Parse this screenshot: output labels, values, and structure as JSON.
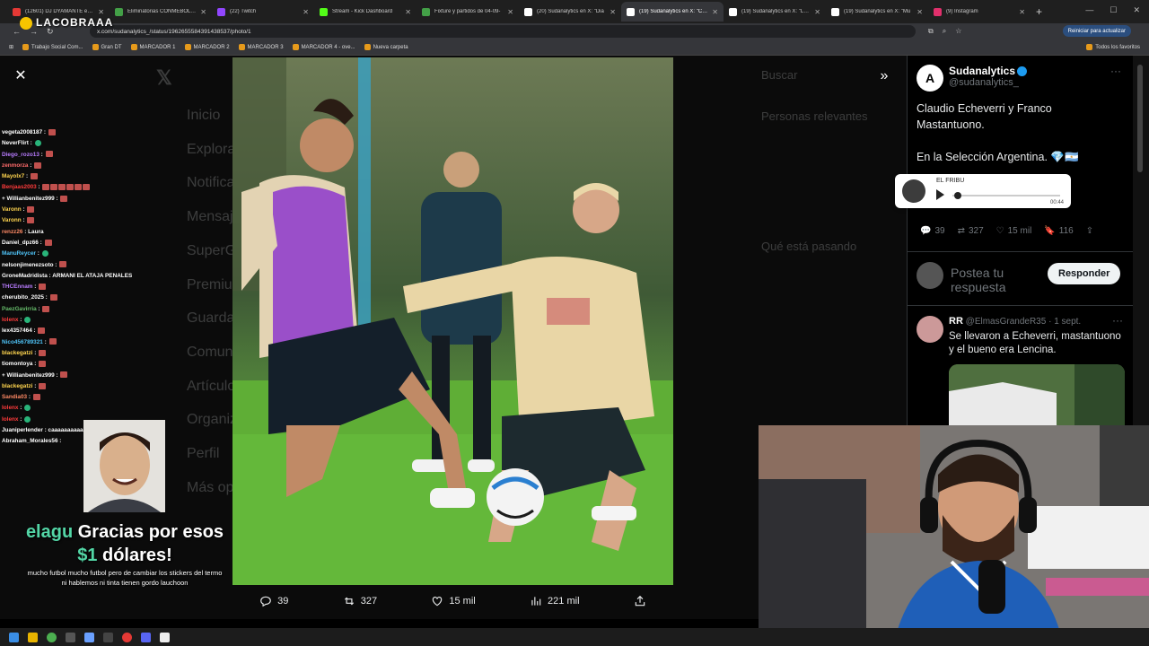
{
  "browser": {
    "tabs": [
      {
        "label": "(12601) DJ DYAMANTE e Dj",
        "color": "#e53935"
      },
      {
        "label": "Eliminatorias CONMEBOL - P",
        "color": "#43a047"
      },
      {
        "label": "(22) Twitch",
        "color": "#9146ff"
      },
      {
        "label": "Stream - Kick Dashboard",
        "color": "#53fc18"
      },
      {
        "label": "Fixture y partidos de 04-09-",
        "color": "#43a047"
      },
      {
        "label": "(20) Sudanalytics en X: \"Dia",
        "color": "#ffffff"
      },
      {
        "label": "(19) Sudanalytics en X: \"Clau",
        "color": "#ffffff",
        "active": true
      },
      {
        "label": "(19) Sudanalytics en X: \"La fe",
        "color": "#ffffff"
      },
      {
        "label": "(19) Sudanalytics en X: \"Mu",
        "color": "#ffffff"
      },
      {
        "label": "(9) Instagram",
        "color": "#e1306c"
      }
    ],
    "new_tab": "+",
    "url": "x.com/sudanalytics_/status/1962655584391438537/photo/1",
    "update_label": "Reiniciar para actualizar",
    "bookmarks": [
      "Trabajo Social Com...",
      "Gran DT",
      "MARCADOR 1",
      "MARCADOR 2",
      "MARCADOR 3",
      "MARCADOR 4 - ove...",
      "Nueva carpeta"
    ],
    "all_bookmarks": "Todos los favoritos"
  },
  "stream_overlay": {
    "logo": "LACOBRAAA",
    "chat": [
      {
        "user": "vegeta2008187",
        "color": "#ffffff",
        "msg": "",
        "emotes": 1
      },
      {
        "user": "NeverFlirt",
        "color": "#ffffff",
        "msg": "",
        "emotes": 1,
        "green": true
      },
      {
        "user": "Diego_rozo13",
        "color": "#b97cff",
        "msg": "",
        "emotes": 1
      },
      {
        "user": "zenmorza",
        "color": "#ff6b6b",
        "msg": "",
        "emotes": 1
      },
      {
        "user": "Mayolx7",
        "color": "#ffd54f",
        "msg": "",
        "emotes": 1
      },
      {
        "user": "Benjaas2003",
        "color": "#ff3b3b",
        "msg": "",
        "emotes": 6
      },
      {
        "user": "+ Willianbenitez999",
        "color": "#ffffff",
        "msg": "",
        "emotes": 1
      },
      {
        "user": "Varonn",
        "color": "#ffd54f",
        "msg": "",
        "emotes": 1
      },
      {
        "user": "Varonn",
        "color": "#ffd54f",
        "msg": "",
        "emotes": 1
      },
      {
        "user": "renzz26",
        "color": "#ff8a65",
        "msg": "Laura",
        "emotes": 0
      },
      {
        "user": "Daniel_dpz66",
        "color": "#ffffff",
        "msg": "",
        "emotes": 1
      },
      {
        "user": "ManuReycer",
        "color": "#4fc3f7",
        "msg": "",
        "emotes": 1,
        "green": true
      },
      {
        "user": "nelsonjimenezsoto",
        "color": "#ffffff",
        "msg": "",
        "emotes": 1
      },
      {
        "user": "GroneMadridista",
        "color": "#ffffff",
        "msg": "ARMANI EL ATAJA PENALES",
        "emotes": 0
      },
      {
        "user": "THCEnnam",
        "color": "#b97cff",
        "msg": "",
        "emotes": 1
      },
      {
        "user": "cherubito_2025",
        "color": "#ffffff",
        "msg": "",
        "emotes": 1
      },
      {
        "user": "PaezGavirria",
        "color": "#66bb6a",
        "msg": "",
        "emotes": 1
      },
      {
        "user": "Iolenx",
        "color": "#ff3b3b",
        "msg": "",
        "emotes": 1,
        "green": true
      },
      {
        "user": "lex4357464",
        "color": "#ffffff",
        "msg": "",
        "emotes": 1
      },
      {
        "user": "Nico456789321",
        "color": "#4fc3f7",
        "msg": "",
        "emotes": 1
      },
      {
        "user": "blackegatzi",
        "color": "#ffd54f",
        "msg": "",
        "emotes": 1
      },
      {
        "user": "tiomontoya",
        "color": "#ffffff",
        "msg": "",
        "emotes": 1
      },
      {
        "user": "+ Willianbenitez999",
        "color": "#ffffff",
        "msg": "",
        "emotes": 1
      },
      {
        "user": "blackegatzi",
        "color": "#ffd54f",
        "msg": "",
        "emotes": 1
      },
      {
        "user": "Sandia03",
        "color": "#ff8a65",
        "msg": "",
        "emotes": 1
      },
      {
        "user": "Iolenx",
        "color": "#ff3b3b",
        "msg": "",
        "emotes": 1,
        "green": true
      },
      {
        "user": "Iolenx",
        "color": "#ff3b3b",
        "msg": "",
        "emotes": 1,
        "green": true
      },
      {
        "user": "Juaniperlender",
        "color": "#ffffff",
        "msg": "caaaaaaaaaaa",
        "emotes": 0
      },
      {
        "user": "Abraham_Morales56",
        "color": "#ffffff",
        "msg": "",
        "emotes": 0
      }
    ],
    "alert_user": "elagu",
    "alert_text": "Gracias por esos",
    "alert_amount": "$1",
    "alert_currency": "dólares!",
    "alert_message_1": "mucho futbol mucho futbol pero de cambiar los stickers del termo",
    "alert_message_2": "ni hablemos ni tinta tienen gordo lauchoon"
  },
  "x_background": {
    "nav": [
      "Inicio",
      "Explorar",
      "Notificaciones",
      "Mensajes",
      "SuperGrok",
      "Premium",
      "Guardados",
      "Comunidades",
      "Artículos",
      "Organizaciones",
      "Perfil",
      "Más opciones"
    ],
    "right_headings": [
      "Buscar",
      "Personas relevantes",
      "Qué está pasando"
    ]
  },
  "photo_actions": {
    "replies": "39",
    "reposts": "327",
    "likes": "15 mil",
    "views": "221 mil"
  },
  "tweet": {
    "author": "Sudanalytics",
    "handle": "@sudanalytics_",
    "text_1": "Claudio Echeverri y Franco Mastantuono.",
    "text_2": "En la Selección Argentina. 💎🇦🇷",
    "replies": "39",
    "reposts": "327",
    "likes": "15 mil",
    "bookmarks": "116",
    "reply_placeholder": "Postea tu respuesta",
    "reply_button": "Responder"
  },
  "reply": {
    "author": "RR",
    "handle": "@ElmasGrandeR35 · 1 sept.",
    "text": "Se llevaron a Echeverri, mastantuono y el bueno era Lencina."
  },
  "audio_widget": {
    "title": "EL FRIBU",
    "time": "00:44"
  },
  "colors": {
    "accent": "#1d9bf0",
    "alert_green": "#53d6a6"
  }
}
